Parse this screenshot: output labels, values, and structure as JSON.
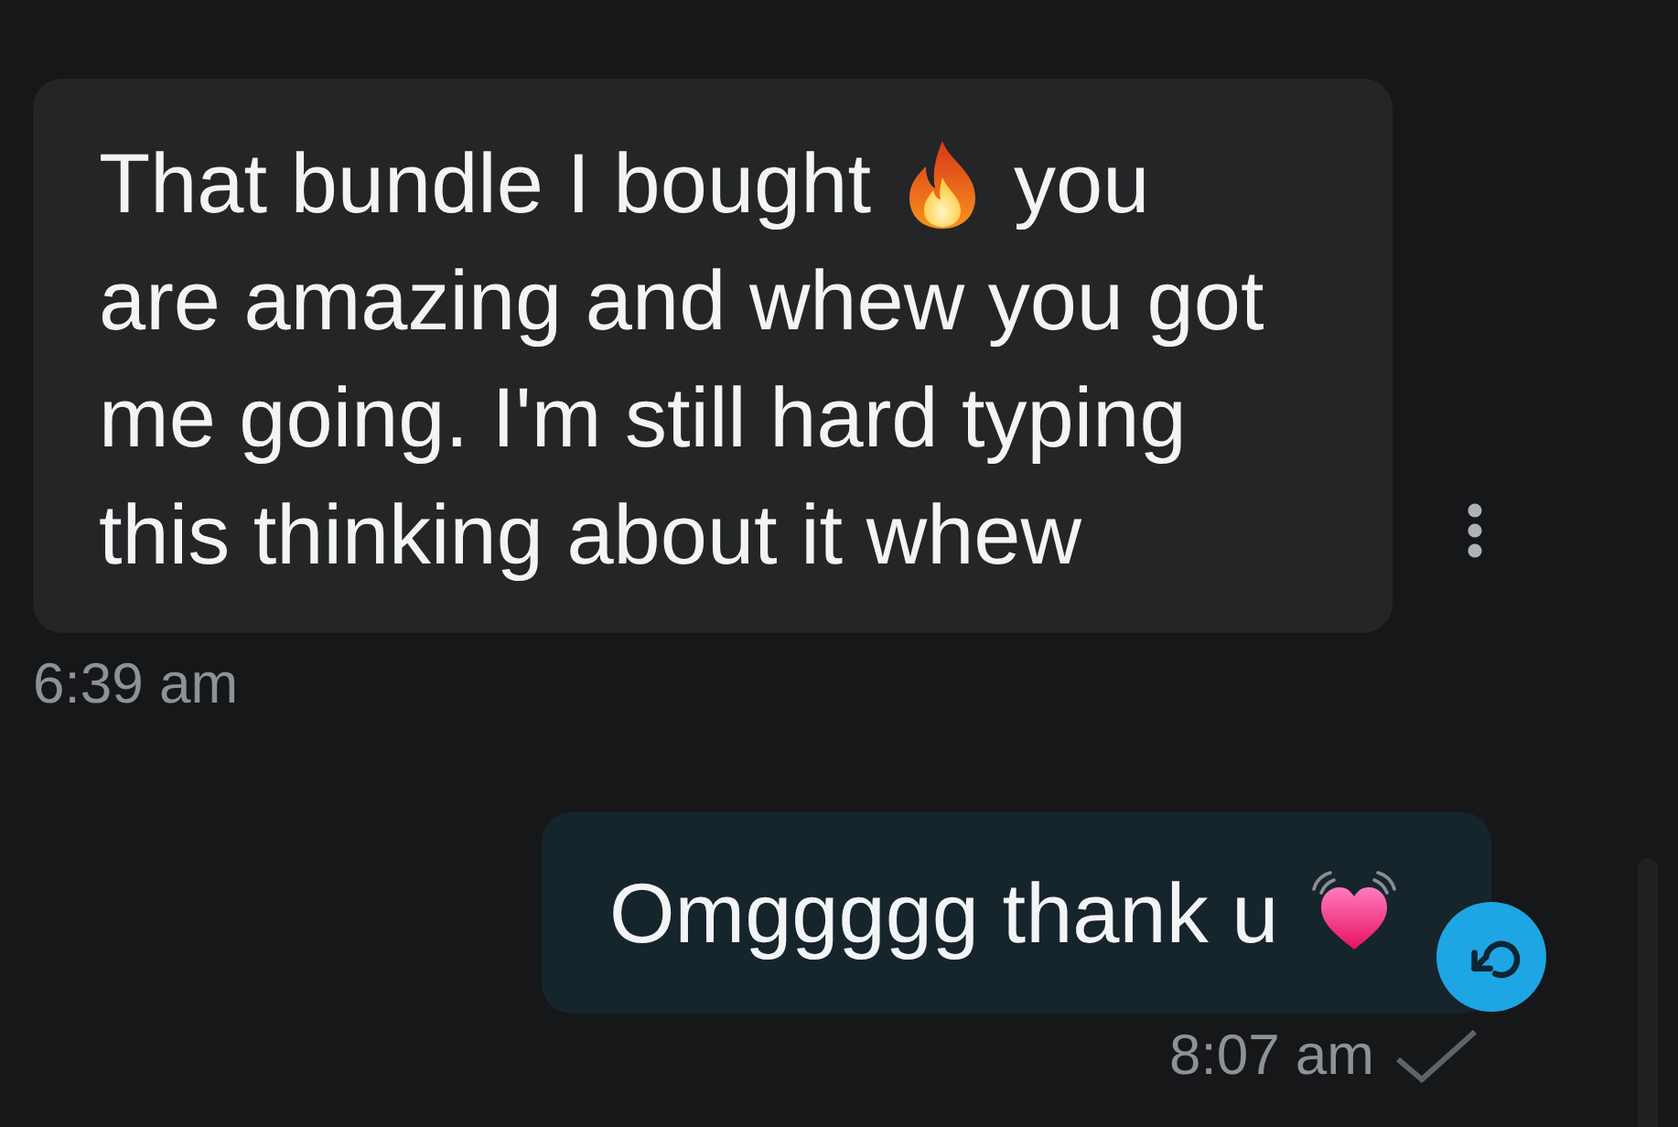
{
  "messages": [
    {
      "kind": "received",
      "parts": [
        {
          "kind": "text",
          "text": "That bundle I bought"
        },
        {
          "kind": "fire"
        },
        {
          "kind": "text",
          "text": "you"
        },
        {
          "kind": "text",
          "text": "are amazing and whew you got me going. I'm still hard typing this thinking about it whew"
        }
      ],
      "time": "6:39 am"
    },
    {
      "kind": "sent",
      "parts": [
        {
          "kind": "text",
          "text": "Omggggg thank u"
        },
        {
          "kind": "heart"
        }
      ],
      "time": "8:07 am",
      "sent": true
    }
  ]
}
